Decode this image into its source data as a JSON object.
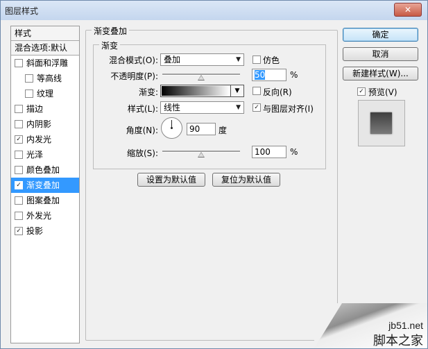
{
  "window": {
    "title": "图层样式",
    "close_glyph": "✕"
  },
  "sidebar": {
    "header": "样式",
    "blend_options": "混合选项:默认",
    "items": [
      {
        "label": "斜面和浮雕",
        "checked": false,
        "indent": false,
        "selected": false
      },
      {
        "label": "等高线",
        "checked": false,
        "indent": true,
        "selected": false
      },
      {
        "label": "纹理",
        "checked": false,
        "indent": true,
        "selected": false
      },
      {
        "label": "描边",
        "checked": false,
        "indent": false,
        "selected": false
      },
      {
        "label": "内阴影",
        "checked": false,
        "indent": false,
        "selected": false
      },
      {
        "label": "内发光",
        "checked": true,
        "indent": false,
        "selected": false
      },
      {
        "label": "光泽",
        "checked": false,
        "indent": false,
        "selected": false
      },
      {
        "label": "颜色叠加",
        "checked": false,
        "indent": false,
        "selected": false
      },
      {
        "label": "渐变叠加",
        "checked": true,
        "indent": false,
        "selected": true
      },
      {
        "label": "图案叠加",
        "checked": false,
        "indent": false,
        "selected": false
      },
      {
        "label": "外发光",
        "checked": false,
        "indent": false,
        "selected": false
      },
      {
        "label": "投影",
        "checked": true,
        "indent": false,
        "selected": false
      }
    ],
    "check_glyph": "✓"
  },
  "panel": {
    "group_title": "渐变叠加",
    "sub_title": "渐变",
    "blend_mode_label": "混合模式(O):",
    "blend_mode_value": "叠加",
    "dither_label": "仿色",
    "dither_checked": false,
    "opacity_label": "不透明度(P):",
    "opacity_value": "50",
    "opacity_fraction": 0.5,
    "percent": "%",
    "gradient_label": "渐变:",
    "gradient_colors": [
      "#000000",
      "#ffffff"
    ],
    "reverse_label": "反向(R)",
    "reverse_checked": false,
    "style_label": "样式(L):",
    "style_value": "线性",
    "align_label": "与图层对齐(I)",
    "align_checked": true,
    "angle_label": "角度(N):",
    "angle_value": "90",
    "angle_unit": "度",
    "scale_label": "缩放(S):",
    "scale_value": "100",
    "scale_fraction": 0.5,
    "make_default": "设置为默认值",
    "reset_default": "复位为默认值",
    "dropdown_glyph": "▼"
  },
  "actions": {
    "ok": "确定",
    "cancel": "取消",
    "new_style": "新建样式(W)...",
    "preview_label": "预览(V)",
    "preview_checked": true
  },
  "watermark": {
    "site": "jb51.net",
    "name": "脚本之家"
  }
}
